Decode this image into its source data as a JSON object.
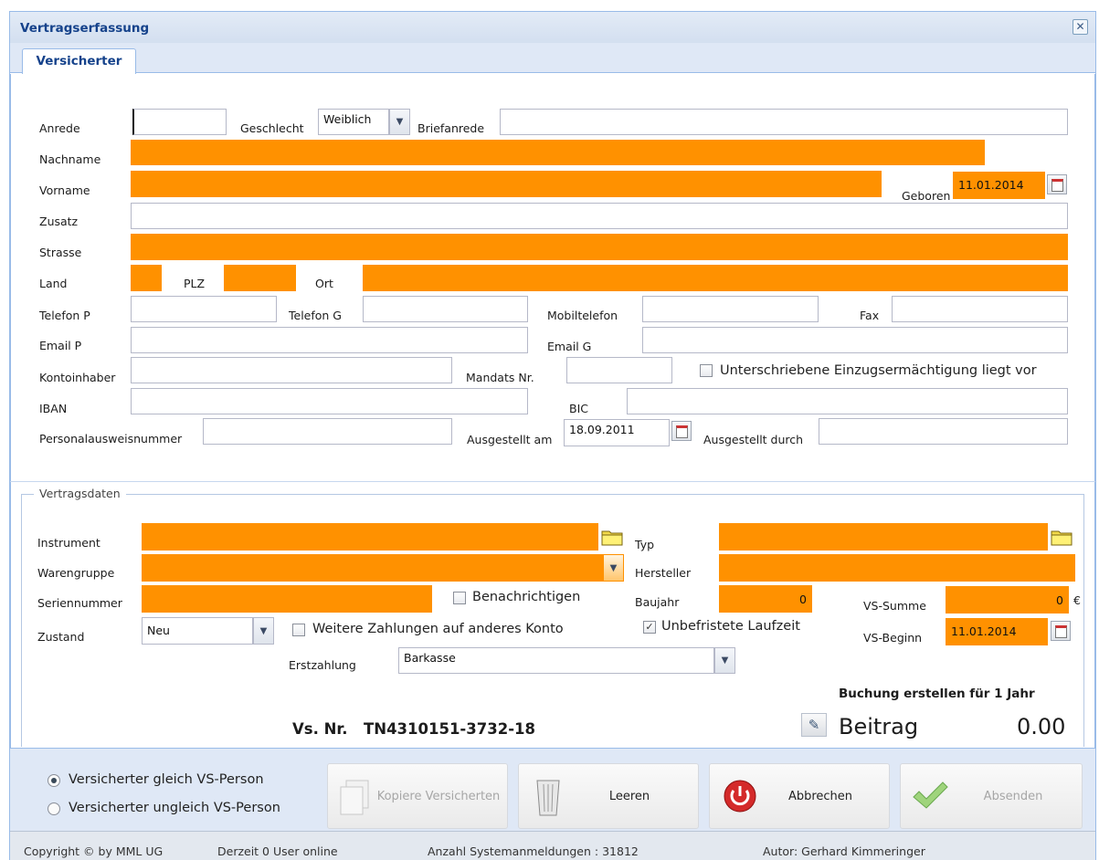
{
  "window": {
    "title": "Vertragserfassung",
    "close_glyph": "✕"
  },
  "tab": {
    "label": "Versicherter"
  },
  "person": {
    "anrede_label": "Anrede",
    "anrede_value": "",
    "geschlecht_label": "Geschlecht",
    "geschlecht_value": "Weiblich",
    "briefanrede_label": "Briefanrede",
    "briefanrede_value": "",
    "nachname_label": "Nachname",
    "nachname_value": "",
    "vorname_label": "Vorname",
    "vorname_value": "",
    "geboren_label": "Geboren",
    "geboren_value": "11.01.2014",
    "zusatz_label": "Zusatz",
    "zusatz_value": "",
    "strasse_label": "Strasse",
    "strasse_value": "",
    "land_label": "Land",
    "land_value": "",
    "plz_label": "PLZ",
    "plz_value": "",
    "ort_label": "Ort",
    "ort_value": "",
    "telefon_p_label": "Telefon P",
    "telefon_p_value": "",
    "telefon_g_label": "Telefon G",
    "telefon_g_value": "",
    "mobil_label": "Mobiltelefon",
    "mobil_value": "",
    "fax_label": "Fax",
    "fax_value": "",
    "email_p_label": "Email P",
    "email_p_value": "",
    "email_g_label": "Email G",
    "email_g_value": "",
    "kontoinhaber_label": "Kontoinhaber",
    "kontoinhaber_value": "",
    "mandat_label": "Mandats Nr.",
    "mandat_value": "",
    "einzug_label": "Unterschriebene Einzugsermächtigung liegt vor",
    "iban_label": "IBAN",
    "iban_value": "",
    "bic_label": "BIC",
    "bic_value": "",
    "ausweis_label": "Personalausweisnummer",
    "ausweis_value": "",
    "ausgestellt_am_label": "Ausgestellt am",
    "ausgestellt_am_value": "18.09.2011",
    "ausgestellt_durch_label": "Ausgestellt durch",
    "ausgestellt_durch_value": ""
  },
  "contract": {
    "legend": "Vertragsdaten",
    "instrument_label": "Instrument",
    "instrument_value": "",
    "typ_label": "Typ",
    "typ_value": "",
    "warengruppe_label": "Warengruppe",
    "warengruppe_value": "",
    "hersteller_label": "Hersteller",
    "hersteller_value": "",
    "seriennummer_label": "Seriennummer",
    "seriennummer_value": "",
    "benachrichtigen_label": "Benachrichtigen",
    "baujahr_label": "Baujahr",
    "baujahr_value": "0",
    "vssumme_label": "VS-Summe",
    "vssumme_value": "0",
    "vssumme_unit": "€",
    "zustand_label": "Zustand",
    "zustand_value": "Neu",
    "weitere_label": "Weitere Zahlungen auf anderes Konto",
    "unbefristet_label": "Unbefristete Laufzeit",
    "unbefristet_checked": "✓",
    "vsbeginn_label": "VS-Beginn",
    "vsbeginn_value": "11.01.2014",
    "erstzahlung_label": "Erstzahlung",
    "erstzahlung_value": "Barkasse",
    "buchung_label": "Buchung erstellen für 1 Jahr",
    "vsnr_prefix": "Vs. Nr.",
    "vsnr_value": "TN4310151-3732-18",
    "beitrag_label": "Beitrag",
    "beitrag_value": "0.00"
  },
  "footer": {
    "radio_gleich": "Versicherter gleich VS-Person",
    "radio_ungleich": "Versicherter ungleich VS-Person",
    "btn_kopiere": "Kopiere Versicherten",
    "btn_leeren": "Leeren",
    "btn_abbrechen": "Abbrechen",
    "btn_absenden": "Absenden"
  },
  "status": {
    "copyright": "Copyright © by MML UG",
    "online": "Derzeit 0 User online",
    "anmeldungen": "Anzahl Systemanmeldungen : 31812",
    "autor": "Autor: Gerhard Kimmeringer"
  },
  "colors": {
    "required": "#ff9100",
    "title_bg": "#dbe5f3",
    "title_text": "#15428b",
    "panel_border": "#99bbe8"
  }
}
